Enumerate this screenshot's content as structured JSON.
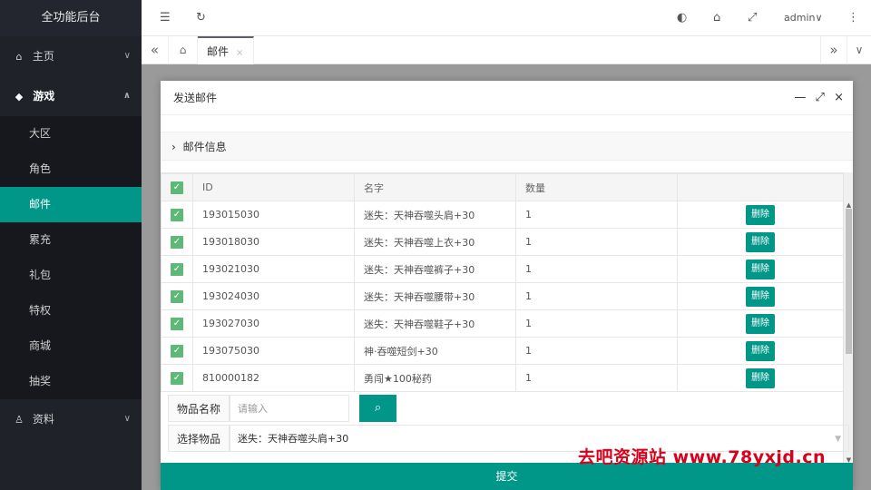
{
  "sidebar": {
    "brand": "全功能后台",
    "items": [
      {
        "icon": "home-icon",
        "glyph": "⌂",
        "label": "主页",
        "arrow": "∨"
      },
      {
        "icon": "diamond-icon",
        "glyph": "◆",
        "label": "游戏",
        "arrow": "∧"
      },
      {
        "icon": "user-icon",
        "glyph": "♙",
        "label": "资料",
        "arrow": "∨"
      }
    ],
    "submenu": [
      "大区",
      "角色",
      "邮件",
      "累充",
      "礼包",
      "特权",
      "商城",
      "抽奖"
    ],
    "active_submenu": "邮件"
  },
  "header": {
    "menu_icon": "☰",
    "refresh_icon": "↻",
    "theme_icon": "◐",
    "tag_icon": "⌂",
    "fullscreen_icon": "⤢",
    "user": "admin",
    "user_caret": "∨",
    "more_icon": "⋮"
  },
  "tabs": {
    "prev": "«",
    "home": "⌂",
    "current": "邮件",
    "close": "×",
    "next": "»",
    "dropdown": "∨"
  },
  "modal": {
    "title": "发送邮件",
    "min": "—",
    "max": "⤢",
    "close": "×",
    "section_arrow": "›",
    "section_title": "邮件信息",
    "table": {
      "headers": [
        "",
        "ID",
        "名字",
        "数量",
        ""
      ],
      "check_glyph": "✓",
      "rows": [
        {
          "id": "193015030",
          "name": "迷失：天神吞噬头肩+30",
          "qty": "1",
          "action": "删除"
        },
        {
          "id": "193018030",
          "name": "迷失：天神吞噬上衣+30",
          "qty": "1",
          "action": "删除"
        },
        {
          "id": "193021030",
          "name": "迷失：天神吞噬裤子+30",
          "qty": "1",
          "action": "删除"
        },
        {
          "id": "193024030",
          "name": "迷失：天神吞噬腰带+30",
          "qty": "1",
          "action": "删除"
        },
        {
          "id": "193027030",
          "name": "迷失：天神吞噬鞋子+30",
          "qty": "1",
          "action": "删除"
        },
        {
          "id": "193075030",
          "name": "神·吞噬短剑+30",
          "qty": "1",
          "action": "删除"
        },
        {
          "id": "810000182",
          "name": "勇闯★100秘药",
          "qty": "1",
          "action": "删除"
        }
      ]
    },
    "item_name_label": "物品名称",
    "item_name_placeholder": "请输入",
    "search_icon": "⌕",
    "select_label": "选择物品",
    "select_value": "迷失：天神吞噬头肩+30",
    "select_caret": "▼",
    "submit": "提交"
  },
  "watermark": "去吧资源站 www.78yxjd.cn",
  "colors": {
    "accent": "#009688",
    "sidebar": "#20222a",
    "checkbox": "#5fb878"
  }
}
